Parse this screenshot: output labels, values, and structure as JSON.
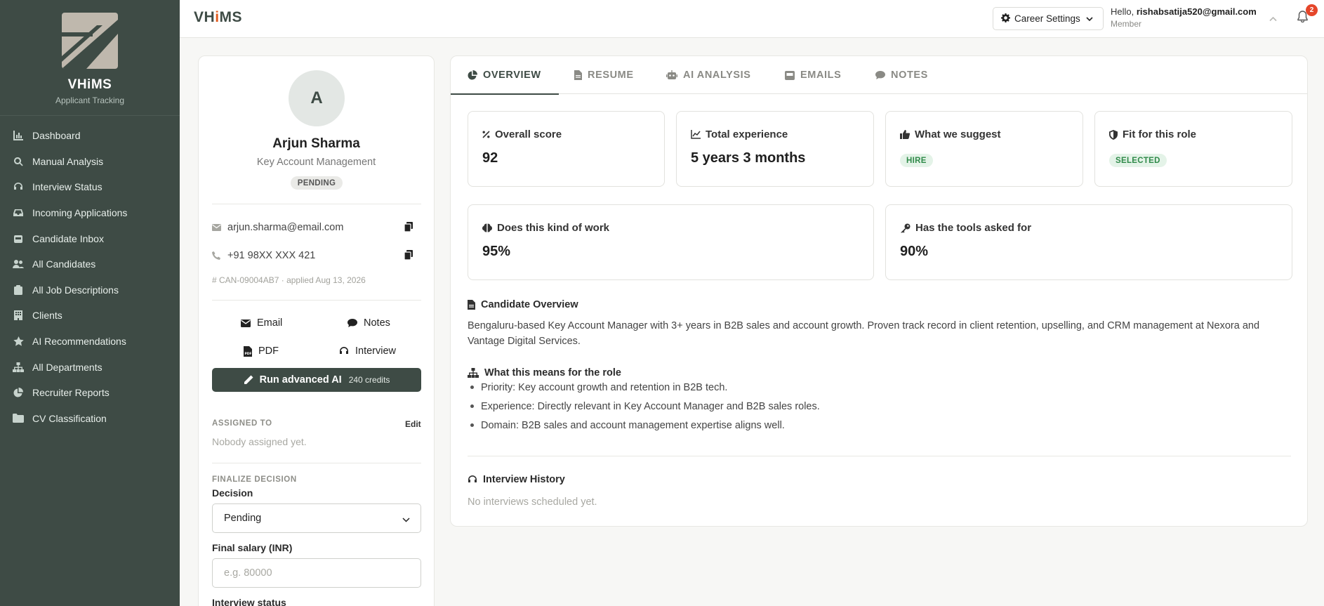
{
  "brand": {
    "name": "VHiMS",
    "subtitle": "Applicant Tracking"
  },
  "sidebar": {
    "items": [
      {
        "label": "Dashboard",
        "icon": "chart-icon"
      },
      {
        "label": "Manual Analysis",
        "icon": "search-icon"
      },
      {
        "label": "Interview Status",
        "icon": "headset-icon"
      },
      {
        "label": "Incoming Applications",
        "icon": "inbox-icon"
      },
      {
        "label": "Candidate Inbox",
        "icon": "inbox-download-icon"
      },
      {
        "label": "All Candidates",
        "icon": "users-icon"
      },
      {
        "label": "All Job Descriptions",
        "icon": "clipboard-icon"
      },
      {
        "label": "Clients",
        "icon": "building-icon"
      },
      {
        "label": "AI Recommendations",
        "icon": "star-icon"
      },
      {
        "label": "All Departments",
        "icon": "sitemap-icon"
      },
      {
        "label": "Recruiter Reports",
        "icon": "pie-chart-icon"
      },
      {
        "label": "CV Classification",
        "icon": "folder-icon"
      }
    ]
  },
  "header": {
    "app_title_pre": "VH",
    "app_title_accent": "i",
    "app_title_post": "MS",
    "career_settings": "Career Settings",
    "greeting": "Hello,",
    "email": "rishabsatija520@gmail.com",
    "role": "Member",
    "notification_count": "2"
  },
  "candidate": {
    "initial": "A",
    "name": "Arjun Sharma",
    "role": "Key Account Management",
    "status": "PENDING",
    "email": "arjun.sharma@email.com",
    "phone": "+91 98XX XXX 421",
    "id_line": "CAN-09004AB7 · applied Aug 13, 2026",
    "actions": {
      "email": "Email",
      "notes": "Notes",
      "pdf": "PDF",
      "interview": "Interview"
    },
    "run_ai": "Run advanced AI",
    "credits": "240 credits",
    "assigned_label": "ASSIGNED TO",
    "edit": "Edit",
    "assigned_value": "Nobody assigned yet.",
    "finalize_label": "FINALIZE DECISION",
    "decision_label": "Decision",
    "decision_value": "Pending",
    "salary_label": "Final salary (INR)",
    "salary_placeholder": "e.g. 80000",
    "interview_status_label": "Interview status"
  },
  "tabs": [
    {
      "label": "OVERVIEW",
      "icon": "pie-chart-icon"
    },
    {
      "label": "RESUME",
      "icon": "file-icon"
    },
    {
      "label": "AI ANALYSIS",
      "icon": "robot-icon"
    },
    {
      "label": "EMAILS",
      "icon": "inbox-icon"
    },
    {
      "label": "NOTES",
      "icon": "comment-icon"
    }
  ],
  "metrics": {
    "overall_score": {
      "label": "Overall score",
      "value": "92"
    },
    "total_experience": {
      "label": "Total experience",
      "value": "5 years 3 months"
    },
    "suggest": {
      "label": "What we suggest",
      "value": "HIRE"
    },
    "fit": {
      "label": "Fit for this role",
      "value": "SELECTED"
    },
    "work": {
      "label": "Does this kind of work",
      "value": "95%"
    },
    "tools": {
      "label": "Has the tools asked for",
      "value": "90%"
    }
  },
  "overview": {
    "heading": "Candidate Overview",
    "text": "Bengaluru-based Key Account Manager with 3+ years in B2B sales and account growth. Proven track record in client retention, upselling, and CRM management at Nexora and Vantage Digital Services.",
    "role_heading": "What this means for the role",
    "bullets": [
      "Priority: Key account growth and retention in B2B tech.",
      "Experience: Directly relevant in Key Account Manager and B2B sales roles.",
      "Domain: B2B sales and account management expertise aligns well."
    ],
    "history_heading": "Interview History",
    "history_empty": "No interviews scheduled yet."
  },
  "colors": {
    "sidebar": "#3e4b45",
    "accent": "#e25a1c",
    "success": "#2f8a49"
  }
}
